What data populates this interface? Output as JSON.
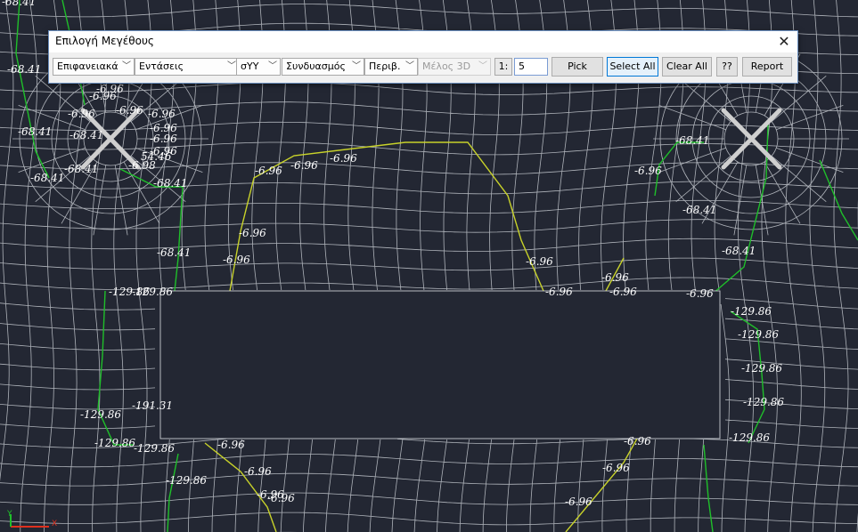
{
  "dialog": {
    "title": "Επιλογή Μεγέθους",
    "close_glyph": "✕",
    "dropdowns": [
      {
        "name": "surface-type-select",
        "value": "Επιφανειακά"
      },
      {
        "name": "quantity-select",
        "value": "Εντάσεις"
      },
      {
        "name": "component-select",
        "value": "σYY"
      },
      {
        "name": "combination-select",
        "value": "Συνδυασμός"
      },
      {
        "name": "envelope-select",
        "value": "Περιβ."
      },
      {
        "name": "member-3d-select",
        "value": "Μέλος 3D",
        "disabled": true
      }
    ],
    "scale_label": "1:",
    "scale_value": "5",
    "buttons": {
      "pick": "Pick",
      "select_all": "Select All",
      "clear_all": "Clear All",
      "help": "??",
      "report": "Report"
    }
  },
  "canvas": {
    "background": "#232733",
    "mesh_color": "#c8ccd2",
    "contour_colors": [
      "#1fbf2a",
      "#c8d22a"
    ],
    "labels": [
      "-68.41",
      "-68.41",
      "-68.41",
      "-68.41",
      "-68.41",
      "-68.41",
      "-68.41",
      "-68.41",
      "-68.41",
      "-68.41",
      "-68.41",
      "-6.96",
      "-6.96",
      "-6.96",
      "-6.96",
      "-6.96",
      "-6.96",
      "-6.96",
      "-6.96",
      "-6.96",
      "-6.96",
      "-6.96",
      "-6.96",
      "-6.96",
      "-6.96",
      "-6.96",
      "-6.96",
      "-6.96",
      "-6.96",
      "-6.96",
      "-6.96",
      "-6.96",
      "-6.96",
      "-6.96",
      "54.46",
      "-6.98",
      "-129.86",
      "-129.86",
      "-129.86",
      "-129.86",
      "-129.86",
      "-129.86",
      "-129.86",
      "-129.86",
      "-129.86",
      "-129.86",
      "-129.86",
      "-191.31",
      "-6.96",
      "-6.96",
      "-6.96"
    ],
    "axis_x": "X",
    "axis_y": "Y"
  }
}
